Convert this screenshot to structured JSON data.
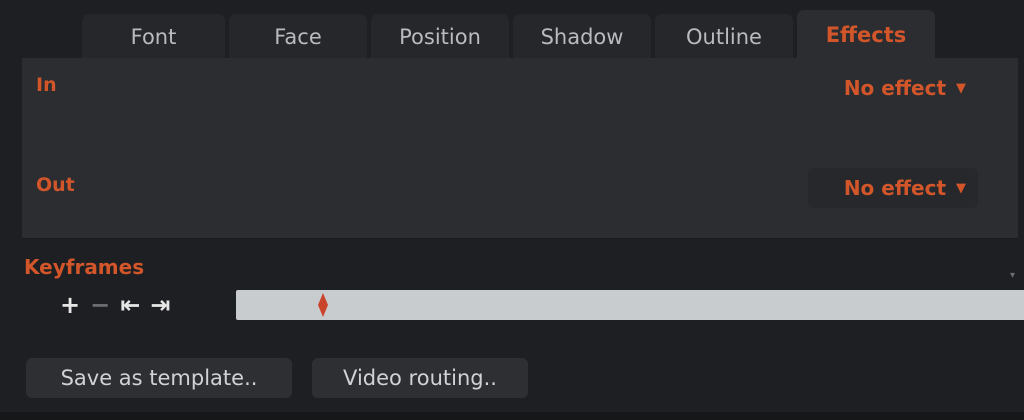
{
  "tabs": [
    {
      "label": "Font",
      "active": false
    },
    {
      "label": "Face",
      "active": false
    },
    {
      "label": "Position",
      "active": false
    },
    {
      "label": "Shadow",
      "active": false
    },
    {
      "label": "Outline",
      "active": false
    },
    {
      "label": "Effects",
      "active": true
    }
  ],
  "effects": {
    "in_label": "In",
    "in_value": "No effect",
    "out_label": "Out",
    "out_value": "No effect"
  },
  "keyframes": {
    "title": "Keyframes",
    "add_icon": "+",
    "remove_icon": "−",
    "prev_icon": "⇤",
    "next_icon": "⇥"
  },
  "buttons": {
    "save_template": "Save as template..",
    "video_routing": "Video routing.."
  },
  "colors": {
    "accent": "#d2562a",
    "panel_bg": "#2b2d31",
    "app_bg": "#1e1f23",
    "timeline_bg": "#c9ccce",
    "keyframe_marker": "#c9442a"
  }
}
